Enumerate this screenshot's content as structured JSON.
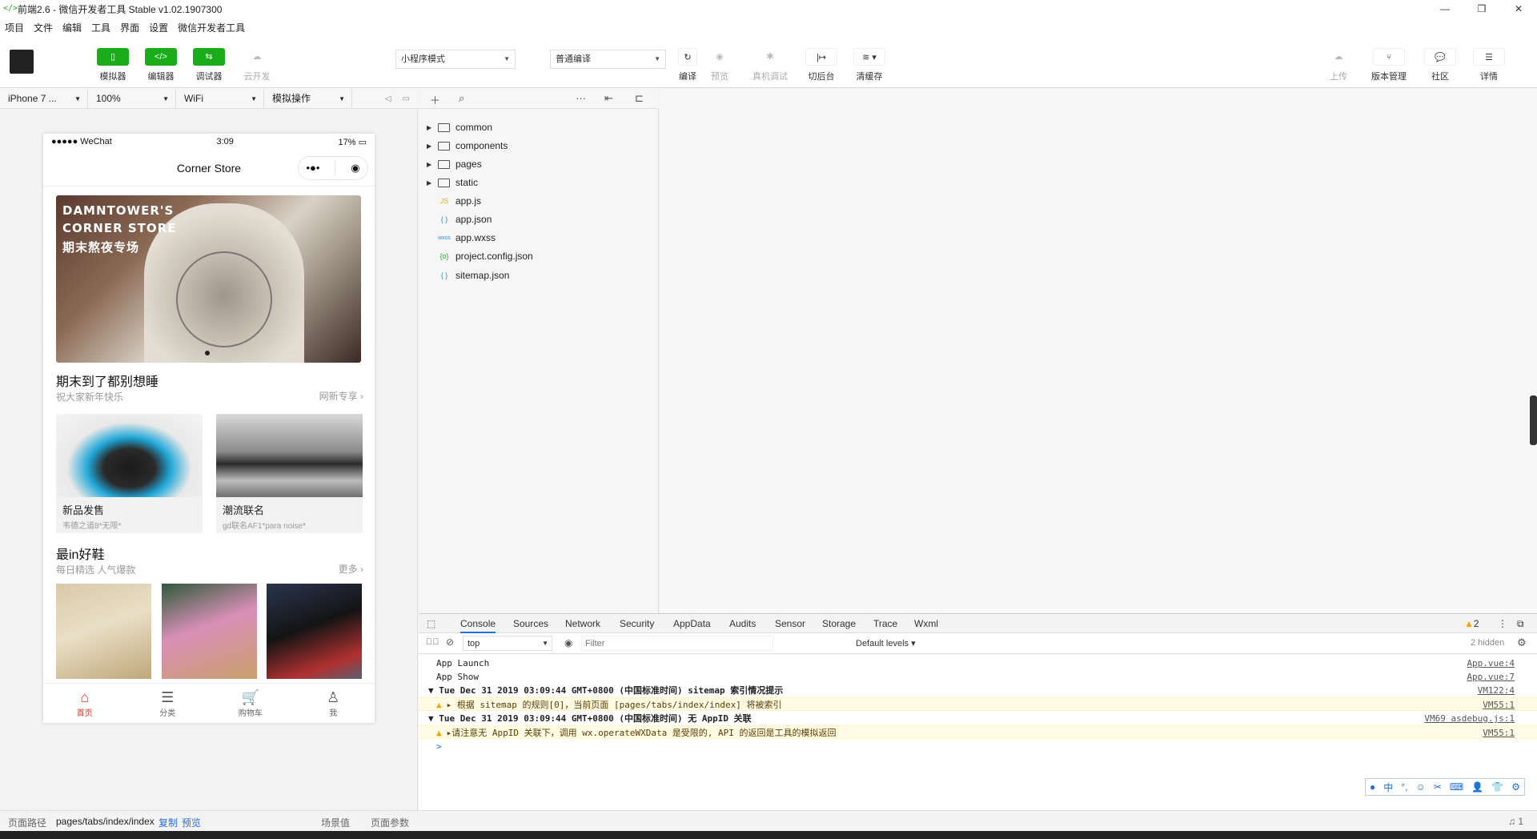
{
  "window": {
    "title": "前端2.6 - 微信开发者工具 Stable v1.02.1907300",
    "app_icon": "</>",
    "controls": [
      "—",
      "❐",
      "✕"
    ]
  },
  "menu": [
    "项目",
    "文件",
    "编辑",
    "工具",
    "界面",
    "设置",
    "微信开发者工具"
  ],
  "toolbar": {
    "simulator": "模拟器",
    "editor": "编辑器",
    "debugger": "调试器",
    "cloud": "云开发",
    "mode": "小程序模式",
    "compile_mode": "普通编译",
    "compile": "编译",
    "preview": "预览",
    "remote_debug": "真机调试",
    "background": "切后台",
    "clear_cache": "清缓存",
    "upload": "上传",
    "version": "版本管理",
    "community": "社区",
    "details": "详情"
  },
  "simbar": {
    "device": "iPhone 7 ...",
    "zoom": "100%",
    "network": "WiFi",
    "operation": "模拟操作"
  },
  "phone": {
    "status_left": "●●●●● WeChat",
    "status_time": "3:09",
    "status_battery": "17%",
    "nav_title": "Corner Store",
    "banner_lines": [
      "DAMNTOWER'S",
      "CORNER STORE",
      "期末熬夜专场"
    ],
    "section1": {
      "title": "期末到了都别想睡",
      "subtitle": "祝大家新年快乐",
      "more": "网新专享"
    },
    "cards": [
      {
        "name": "新品发售",
        "desc": "韦德之道8*无限*"
      },
      {
        "name": "潮流联名",
        "desc": "gd联名AF1*para noise*"
      }
    ],
    "section2": {
      "title": "最in好鞋",
      "subtitle": "每日精选 人气爆款",
      "more": "更多"
    },
    "tabs": [
      "首页",
      "分类",
      "购物车",
      "我"
    ]
  },
  "pathbar": {
    "label": "页面路径",
    "path": "pages/tabs/index/index",
    "copy": "复制",
    "preview": "预览",
    "scene": "场景值",
    "params": "页面参数"
  },
  "tree": {
    "folders": [
      "common",
      "components",
      "pages",
      "static"
    ],
    "files": [
      {
        "name": "app.js",
        "icon": "JS",
        "color": "#e8b300"
      },
      {
        "name": "app.json",
        "icon": "{ }",
        "color": "#2b8fd8"
      },
      {
        "name": "app.wxss",
        "icon": "wxss",
        "color": "#2b8fd8"
      },
      {
        "name": "project.config.json",
        "icon": "{o}",
        "color": "#1aad19"
      },
      {
        "name": "sitemap.json",
        "icon": "{ }",
        "color": "#2b8fd8"
      }
    ]
  },
  "devtools": {
    "tabs": [
      "Console",
      "Sources",
      "Network",
      "Security",
      "AppData",
      "Audits",
      "Sensor",
      "Storage",
      "Trace",
      "Wxml"
    ],
    "warn_count": "2",
    "context": "top",
    "filter_placeholder": "Filter",
    "levels": "Default levels ▾",
    "hidden": "2 hidden",
    "lines": [
      {
        "text": "App Launch",
        "src": "App.vue:4",
        "kind": "log"
      },
      {
        "text": "App Show",
        "src": "App.vue:7",
        "kind": "log"
      },
      {
        "text": "Tue Dec 31 2019 03:09:44 GMT+0800 (中国标准时间) sitemap 索引情况提示",
        "src": "VM122:4",
        "kind": "group"
      },
      {
        "text": "▸ 根据 sitemap 的规则[0]，当前页面 [pages/tabs/index/index] 将被索引",
        "src": "VM55:1",
        "kind": "warn"
      },
      {
        "text": "Tue Dec 31 2019 03:09:44 GMT+0800 (中国标准时间) 无 AppID 关联",
        "src": "VM69 asdebug.js:1",
        "kind": "group"
      },
      {
        "text": "▸请注意无 AppID 关联下，调用 wx.operateWXData 是受限的, API 的返回是工具的模拟返回",
        "src": "VM55:1",
        "kind": "warn"
      }
    ],
    "prompt": ">"
  },
  "ime": [
    "中",
    "°,",
    "☺",
    "✂",
    "⌨",
    "👤",
    "👕",
    "⚙"
  ]
}
